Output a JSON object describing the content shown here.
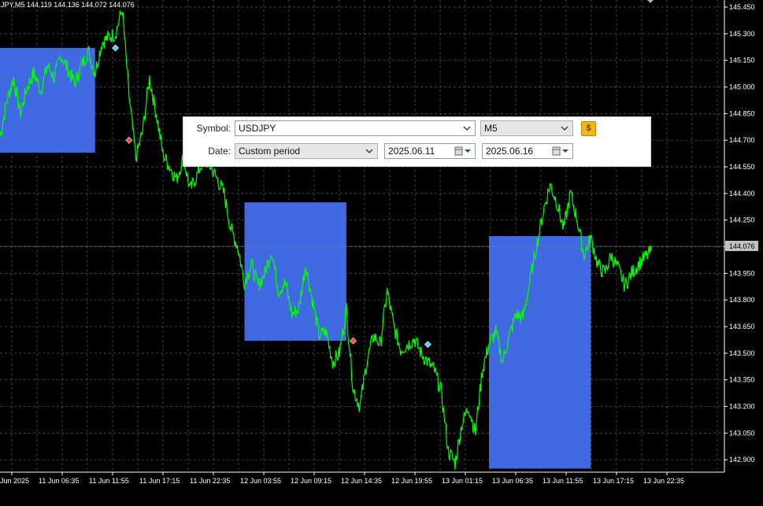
{
  "chart_header": "JPY,M5  144.119 144.136 144.072 144.076",
  "colors": {
    "background": "#000000",
    "price_line": "#00ff00",
    "highlight_box": "#4169e1",
    "grid": "#5a5a5a"
  },
  "current_price_label": "144.076",
  "chart_data": {
    "type": "line",
    "y_ticks": [
      "145.450",
      "145.300",
      "145.150",
      "145.000",
      "144.850",
      "144.700",
      "144.550",
      "144.400",
      "144.250",
      "144.100",
      "143.950",
      "143.800",
      "143.650",
      "143.500",
      "143.350",
      "143.200",
      "143.050",
      "142.900"
    ],
    "ylim": [
      142.83,
      145.49
    ],
    "x_ticks": [
      "Jun 2025",
      "11 Jun 06:35",
      "11 Jun 11:55",
      "11 Jun 17:15",
      "11 Jun 22:35",
      "12 Jun 03:55",
      "12 Jun 09:15",
      "12 Jun 14:35",
      "12 Jun 19:55",
      "13 Jun 01:15",
      "13 Jun 06:35",
      "13 Jun 11:55",
      "13 Jun 17:15",
      "13 Jun 22:35"
    ],
    "series": [
      {
        "values": [
          144.72,
          144.92,
          145.05,
          144.85,
          145.0,
          145.08,
          144.98,
          145.12,
          145.05,
          145.18,
          145.1,
          145.02,
          145.12,
          145.2,
          145.08,
          145.25,
          145.28,
          145.3,
          145.44,
          144.95,
          144.6,
          144.75,
          145.05,
          144.85,
          144.62,
          144.55,
          144.48,
          144.6,
          144.42,
          144.5,
          144.6,
          144.55,
          144.48,
          144.4,
          144.2,
          144.1,
          143.9,
          144.0,
          143.88,
          143.95,
          144.08,
          143.85,
          143.9,
          143.72,
          143.75,
          144.0,
          143.8,
          143.6,
          143.62,
          143.45,
          143.5,
          143.75,
          143.3,
          143.2,
          143.45,
          143.6,
          143.55,
          143.85,
          143.65,
          143.52,
          143.55,
          143.58,
          143.5,
          143.45,
          143.4,
          143.28,
          142.95,
          142.88,
          143.1,
          143.2,
          143.05,
          143.4,
          143.55,
          143.62,
          143.45,
          143.6,
          143.72,
          143.7,
          143.9,
          144.1,
          144.3,
          144.45,
          144.35,
          144.2,
          144.4,
          144.25,
          144.05,
          144.15,
          144.0,
          143.95,
          144.05,
          143.98,
          143.88,
          143.95,
          144.0,
          144.04,
          144.076
        ]
      }
    ],
    "boxes": [
      {
        "x_start_index": 0,
        "x_end_index": 14,
        "y_top": 145.22,
        "y_bottom": 144.63
      },
      {
        "x_start_index": 36,
        "x_end_index": 51,
        "y_top": 144.35,
        "y_bottom": 143.57
      },
      {
        "x_start_index": 72,
        "x_end_index": 87,
        "y_top": 144.16,
        "y_bottom": 142.85
      }
    ],
    "markers": [
      {
        "index": 17,
        "value": 145.22,
        "color": "#5bc8ff"
      },
      {
        "index": 19,
        "value": 144.7,
        "color": "#ff4444"
      },
      {
        "index": 52,
        "value": 143.57,
        "color": "#ff4444"
      },
      {
        "index": 63,
        "value": 143.55,
        "color": "#5bc8ff"
      }
    ],
    "grid": true
  },
  "panel": {
    "symbol_label": "Symbol:",
    "symbol_value": "USDJPY",
    "timeframe_value": "M5",
    "date_label": "Date:",
    "period_value": "Custom period",
    "date_from": "2025.06.11",
    "date_to": "2025.06.16",
    "money_glyph": "$"
  }
}
